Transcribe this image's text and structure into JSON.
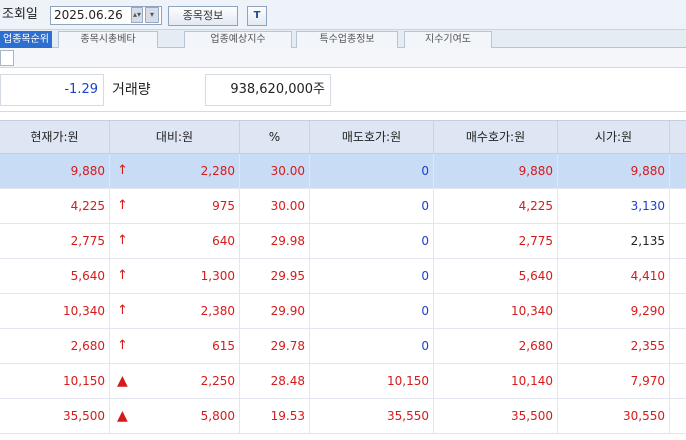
{
  "toolbar": {
    "date_label": "조회일",
    "date_value": "2025.06.26",
    "spin_icon": "spin-arrows-icon",
    "calendar_icon": "calendar-icon",
    "info_button": "종목정보",
    "t_button": "T"
  },
  "tabs": [
    {
      "label": "업종목순위",
      "active": true
    },
    {
      "label": "종목시총베타",
      "active": false
    },
    {
      "label": "업종예상지수",
      "active": false
    },
    {
      "label": "특수업종정보",
      "active": false
    },
    {
      "label": "지수기여도",
      "active": false
    }
  ],
  "summary": {
    "change_value": "-1.29",
    "volume_label": "거래량",
    "volume_value": "938,620,000주"
  },
  "columns": [
    "현재가:원",
    "대비:원",
    "%",
    "매도호가:원",
    "매수호가:원",
    "시가:원"
  ],
  "rows": [
    {
      "price": "9,880",
      "arrow": "↑",
      "change": "2,280",
      "pct": "30.00",
      "ask": "0",
      "bid": "9,880",
      "open": "9,880",
      "open_color": "up",
      "ask_color": "dn",
      "selected": true
    },
    {
      "price": "4,225",
      "arrow": "↑",
      "change": "975",
      "pct": "30.00",
      "ask": "0",
      "bid": "4,225",
      "open": "3,130",
      "open_color": "dn",
      "ask_color": "dn",
      "selected": false
    },
    {
      "price": "2,775",
      "arrow": "↑",
      "change": "640",
      "pct": "29.98",
      "ask": "0",
      "bid": "2,775",
      "open": "2,135",
      "open_color": "ne",
      "ask_color": "dn",
      "selected": false
    },
    {
      "price": "5,640",
      "arrow": "↑",
      "change": "1,300",
      "pct": "29.95",
      "ask": "0",
      "bid": "5,640",
      "open": "4,410",
      "open_color": "up",
      "ask_color": "dn",
      "selected": false
    },
    {
      "price": "10,340",
      "arrow": "↑",
      "change": "2,380",
      "pct": "29.90",
      "ask": "0",
      "bid": "10,340",
      "open": "9,290",
      "open_color": "up",
      "ask_color": "dn",
      "selected": false
    },
    {
      "price": "2,680",
      "arrow": "↑",
      "change": "615",
      "pct": "29.78",
      "ask": "0",
      "bid": "2,680",
      "open": "2,355",
      "open_color": "up",
      "ask_color": "dn",
      "selected": false
    },
    {
      "price": "10,150",
      "arrow": "▲",
      "change": "2,250",
      "pct": "28.48",
      "ask": "10,150",
      "bid": "10,140",
      "open": "7,970",
      "open_color": "up",
      "ask_color": "up",
      "selected": false
    },
    {
      "price": "35,500",
      "arrow": "▲",
      "change": "5,800",
      "pct": "19.53",
      "ask": "35,550",
      "bid": "35,500",
      "open": "30,550",
      "open_color": "up",
      "ask_color": "up",
      "selected": false
    }
  ],
  "colors": {
    "up": "#d61a1a",
    "down": "#1c3fcf",
    "selected_row": "#c8dcf6",
    "active_tab": "#2c6fd1"
  }
}
